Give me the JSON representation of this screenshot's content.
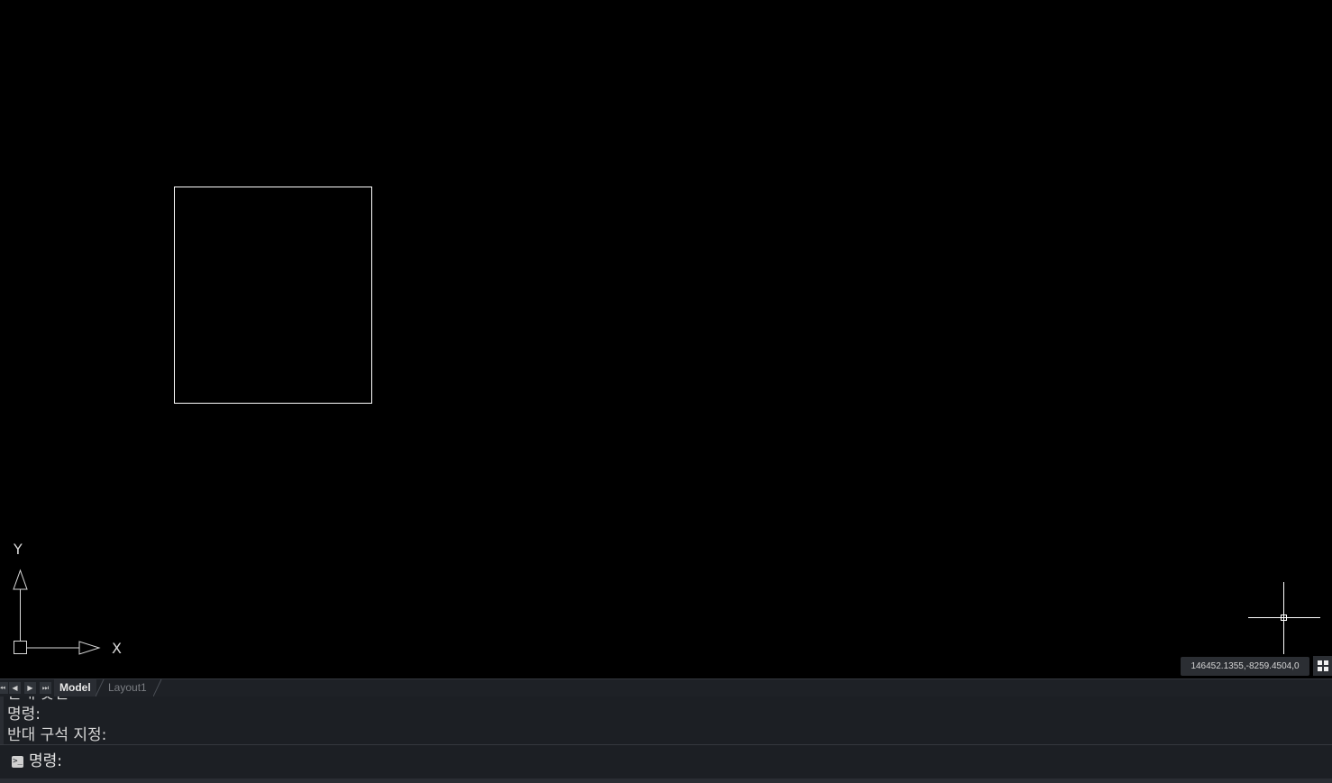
{
  "canvas": {
    "background": "#000000",
    "entity_color": "#ffffff",
    "ucs": {
      "x_label": "X",
      "y_label": "Y"
    },
    "crosshair": "crosshair-cursor"
  },
  "status": {
    "coordinates": "146452.1355,-8259.4504,0",
    "grid_icon": "view-grid-icon"
  },
  "tabs": {
    "nav_first": "first-tab-icon",
    "nav_prev": "prev-tab-icon",
    "nav_next": "next-tab-icon",
    "nav_last": "last-tab-icon",
    "items": [
      {
        "label": "Model",
        "active": true
      },
      {
        "label": "Layout1",
        "active": false
      }
    ]
  },
  "command_history": {
    "lines": [
      "반대 옷션",
      "명령:",
      "반대 구석 지정:"
    ]
  },
  "command_line": {
    "icon": "command-prompt-icon",
    "prompt": "명령:",
    "value": ""
  }
}
